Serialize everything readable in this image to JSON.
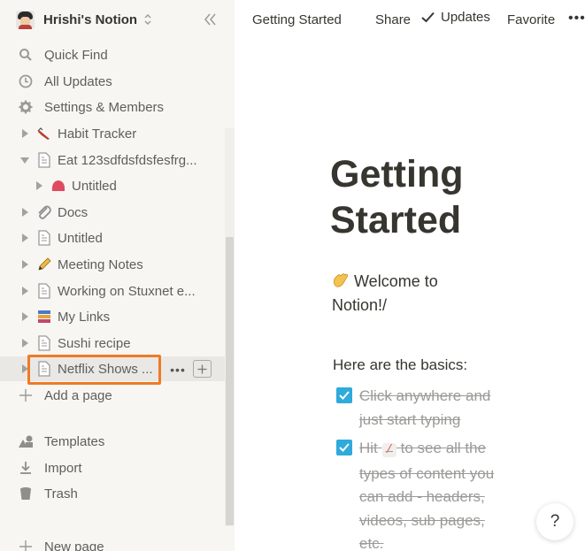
{
  "workspace": {
    "name": "Hrishi's Notion"
  },
  "sidebar": {
    "top_items": [
      {
        "label": "Quick Find",
        "icon": "search-icon"
      },
      {
        "label": "All Updates",
        "icon": "clock-icon"
      },
      {
        "label": "Settings & Members",
        "icon": "gear-icon"
      }
    ],
    "pages": [
      {
        "label": "Habit Tracker",
        "icon": "shoe-emoji-icon",
        "expanded": false
      },
      {
        "label": "Eat 123sdfdsfdsfesfrg...",
        "icon": "page-icon",
        "expanded": true
      },
      {
        "label": "Untitled",
        "icon": "red-emoji-icon",
        "expanded": false,
        "child": true
      },
      {
        "label": "Docs",
        "icon": "paperclip-icon",
        "expanded": false
      },
      {
        "label": "Untitled",
        "icon": "page-icon",
        "expanded": false
      },
      {
        "label": "Meeting Notes",
        "icon": "pencil-icon",
        "expanded": false
      },
      {
        "label": "Working on Stuxnet e...",
        "icon": "page-icon",
        "expanded": false
      },
      {
        "label": "My Links",
        "icon": "books-icon",
        "expanded": false
      },
      {
        "label": "Sushi recipe",
        "icon": "page-icon",
        "expanded": false
      },
      {
        "label": "Netflix Shows ...",
        "icon": "page-icon",
        "expanded": false,
        "hovered": true
      }
    ],
    "add_page": "Add a page",
    "bottom_items": [
      {
        "label": "Templates",
        "icon": "templates-icon"
      },
      {
        "label": "Import",
        "icon": "import-icon"
      },
      {
        "label": "Trash",
        "icon": "trash-icon"
      }
    ],
    "new_page": "New page"
  },
  "topbar": {
    "breadcrumb": "Getting Started",
    "share": "Share",
    "updates": "Updates",
    "favorite": "Favorite",
    "more": "•••"
  },
  "content": {
    "title_line1": "Getting",
    "title_line2": "Started",
    "welcome": "Welcome to Notion!/",
    "basics": "Here are the basics:",
    "todos": [
      {
        "text": "Click anywhere and just start typing",
        "checked": true
      },
      {
        "text_before": "Hit",
        "code": "/",
        "text_after": "to see all the types of content you can add - headers, videos, sub pages, etc.",
        "checked": true
      }
    ]
  },
  "help": "?",
  "colors": {
    "sidebar_bg": "#f7f6f3",
    "highlight": "#f07a25",
    "checkbox": "#2eaadc",
    "text": "#37352f"
  }
}
